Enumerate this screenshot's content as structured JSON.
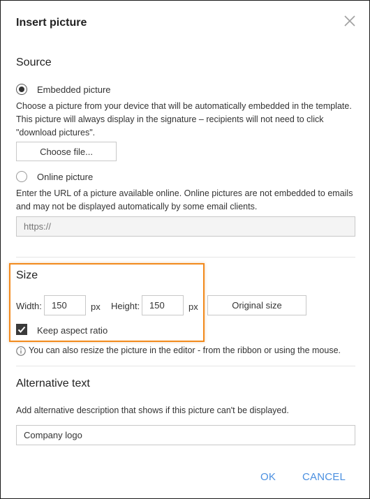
{
  "dialog": {
    "title": "Insert picture",
    "close_icon": "close-icon"
  },
  "source": {
    "heading": "Source",
    "embedded": {
      "label": "Embedded picture",
      "selected": true,
      "description": "Choose a picture from your device that will be automatically embedded in the template. This picture will always display in the signature – recipients will not need to click \"download pictures\".",
      "choose_file_label": "Choose file..."
    },
    "online": {
      "label": "Online picture",
      "selected": false,
      "description": "Enter the URL of a picture available online. Online pictures are not embedded to emails and may not be displayed automatically by some email clients.",
      "url_placeholder": "https://",
      "url_value": ""
    }
  },
  "size": {
    "heading": "Size",
    "width_label": "Width:",
    "width_value": "150",
    "width_unit": "px",
    "height_label": "Height:",
    "height_value": "150",
    "height_unit": "px",
    "original_size_label": "Original size",
    "keep_aspect_label": "Keep aspect ratio",
    "keep_aspect_checked": true,
    "info_icon": "info-icon",
    "info_text": "You can also resize the picture in the editor - from the ribbon or using the mouse.",
    "highlight_color": "#f28a1c"
  },
  "alt_text": {
    "heading": "Alternative text",
    "description": "Add alternative description that shows if this picture can't be displayed.",
    "value": "Company logo"
  },
  "footer": {
    "ok_label": "OK",
    "cancel_label": "CANCEL",
    "button_color": "#4a8fe0"
  }
}
